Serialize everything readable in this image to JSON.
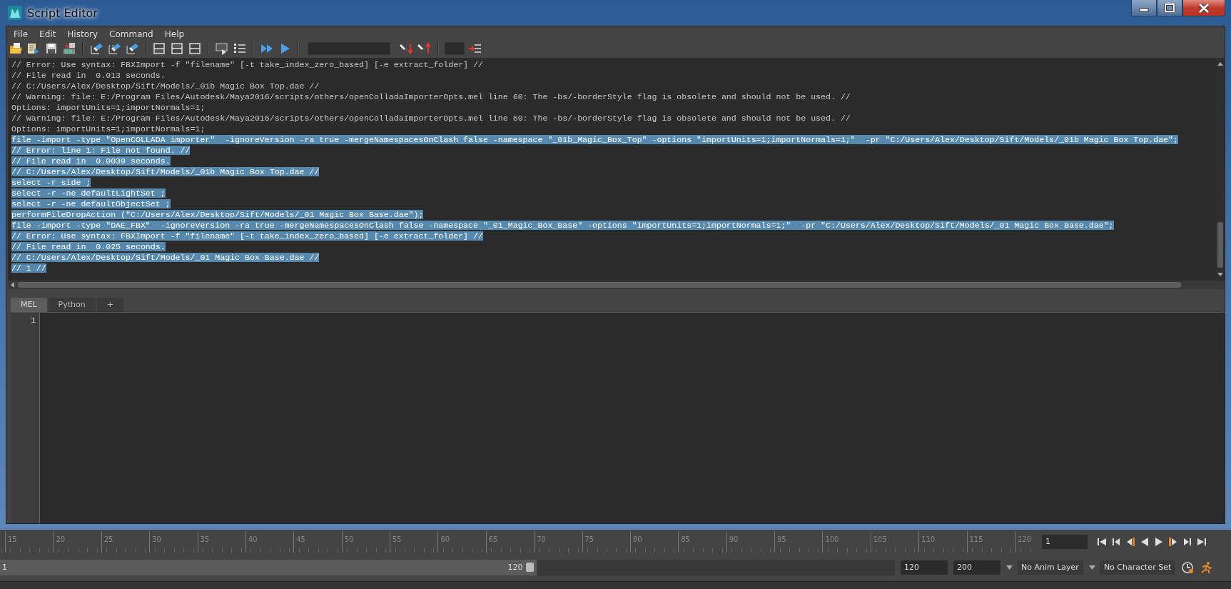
{
  "window": {
    "title": "Script Editor"
  },
  "menu": [
    "File",
    "Edit",
    "History",
    "Command",
    "Help"
  ],
  "log": {
    "lines": [
      {
        "text": "// Error: Use syntax: FBXImport -f \"filename\" [-t take_index_zero_based] [-e extract_folder] //",
        "selected": false
      },
      {
        "text": "// File read in  0.013 seconds.",
        "selected": false
      },
      {
        "text": "// C:/Users/Alex/Desktop/Sift/Models/_01b Magic Box Top.dae //",
        "selected": false
      },
      {
        "text": "// Warning: file: E:/Program Files/Autodesk/Maya2016/scripts/others/openColladaImporterOpts.mel line 60: The -bs/-borderStyle flag is obsolete and should not be used. //",
        "selected": false
      },
      {
        "text": "Options: importUnits=1;importNormals=1;",
        "selected": false
      },
      {
        "text": "// Warning: file: E:/Program Files/Autodesk/Maya2016/scripts/others/openColladaImporterOpts.mel line 60: The -bs/-borderStyle flag is obsolete and should not be used. //",
        "selected": false
      },
      {
        "text": "Options: importUnits=1;importNormals=1;",
        "selected": false
      },
      {
        "text": "file -import -type \"OpenCOLLADA importer\"  -ignoreVersion -ra true -mergeNamespacesOnClash false -namespace \"_01b_Magic_Box_Top\" -options \"importUnits=1;importNormals=1;\"  -pr \"C:/Users/Alex/Desktop/Sift/Models/_01b Magic Box Top.dae\";",
        "selected": true
      },
      {
        "text": "// Error: line 1: File not found. //",
        "selected": true
      },
      {
        "text": "// File read in  0.0039 seconds.",
        "selected": true
      },
      {
        "text": "// C:/Users/Alex/Desktop/Sift/Models/_01b Magic Box Top.dae //",
        "selected": true
      },
      {
        "text": "select -r side ;",
        "selected": true
      },
      {
        "text": "select -r -ne defaultLightSet ;",
        "selected": true
      },
      {
        "text": "select -r -ne defaultObjectSet ;",
        "selected": true
      },
      {
        "text": "performFileDropAction (\"C:/Users/Alex/Desktop/Sift/Models/_01 Magic Box Base.dae\");",
        "selected": true
      },
      {
        "text": "file -import -type \"DAE_FBX\"  -ignoreVersion -ra true -mergeNamespacesOnClash false -namespace \"_01_Magic_Box_Base\" -options \"importUnits=1;importNormals=1;\"  -pr \"C:/Users/Alex/Desktop/Sift/Models/_01 Magic Box Base.dae\";",
        "selected": true
      },
      {
        "text": "// Error: Use syntax: FBXImport -f \"filename\" [-t take_index_zero_based] [-e extract_folder] //",
        "selected": true
      },
      {
        "text": "// File read in  0.025 seconds.",
        "selected": true
      },
      {
        "text": "// C:/Users/Alex/Desktop/Sift/Models/_01 Magic Box Base.dae //",
        "selected": true
      },
      {
        "text": "// 1 //",
        "selected": true
      }
    ]
  },
  "tabs": [
    {
      "label": "MEL",
      "selected": true
    },
    {
      "label": "Python",
      "selected": false
    },
    {
      "label": "+",
      "selected": false
    }
  ],
  "editor": {
    "line_numbers": [
      "1"
    ]
  },
  "timeline": {
    "ticks": [
      "15",
      "20",
      "25",
      "30",
      "35",
      "40",
      "45",
      "50",
      "55",
      "60",
      "65",
      "70",
      "75",
      "80",
      "85",
      "90",
      "95",
      "100",
      "105",
      "110",
      "115",
      "120"
    ],
    "current_frame": "1"
  },
  "range": {
    "level": 0.6,
    "start": "1",
    "end": "120",
    "playback_end": "120",
    "animation_end": "200",
    "anim_layer": "No Anim Layer",
    "character_set": "No Character Set"
  }
}
